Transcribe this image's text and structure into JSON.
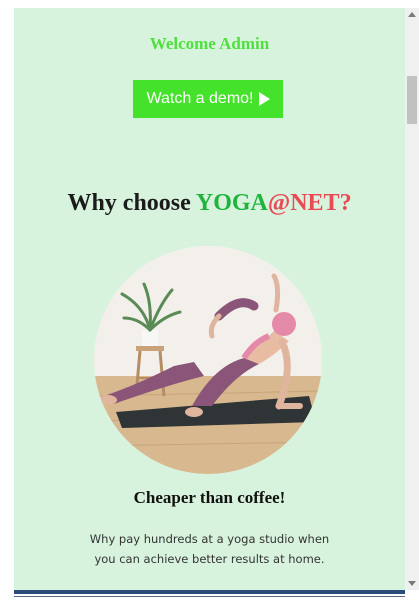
{
  "header": {
    "welcome_text": "Welcome Admin",
    "demo_button_label": "Watch a demo!"
  },
  "hero": {
    "headline_prefix": "Why choose ",
    "brand_part1": "YOGA",
    "brand_part2": "@NET?"
  },
  "feature": {
    "title": "Cheaper than coffee!",
    "description": "Why pay hundreds at a yoga studio when you can achieve better results at home."
  },
  "colors": {
    "page_background": "#d8f3dd",
    "accent_green": "#44e22a",
    "brand_green": "#1fb43c",
    "brand_red": "#ea4a55"
  },
  "icons": {
    "demo_button_icon": "play-icon"
  }
}
